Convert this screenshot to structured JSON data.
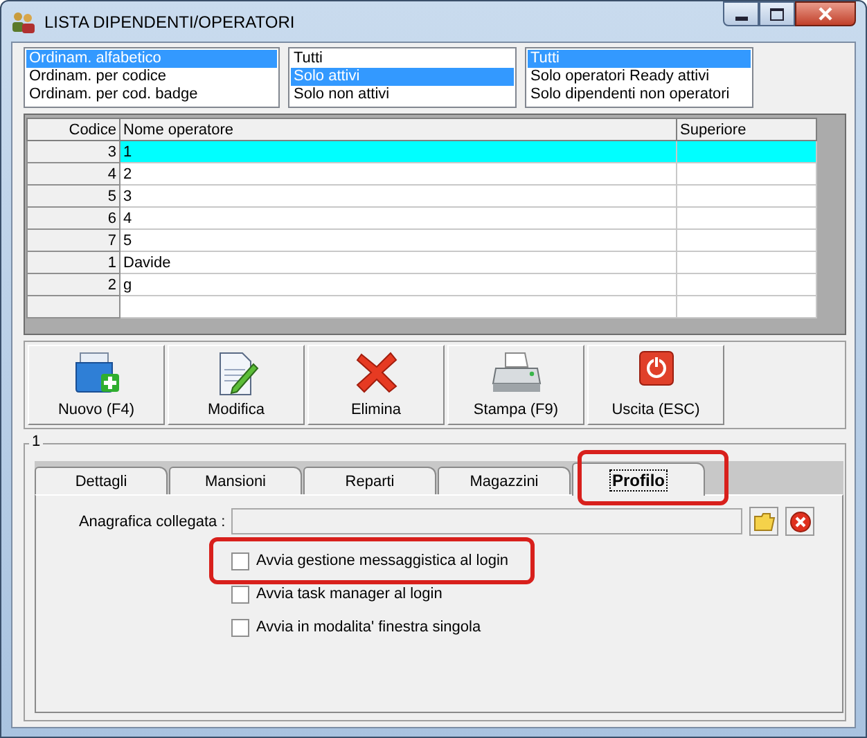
{
  "window": {
    "title": "LISTA DIPENDENTI/OPERATORI"
  },
  "filters": [
    {
      "items": [
        {
          "label": "Ordinam. alfabetico",
          "selected": true
        },
        {
          "label": "Ordinam. per codice",
          "selected": false
        },
        {
          "label": "Ordinam. per cod. badge",
          "selected": false
        }
      ]
    },
    {
      "items": [
        {
          "label": "Tutti",
          "selected": false
        },
        {
          "label": "Solo attivi",
          "selected": true
        },
        {
          "label": "Solo non attivi",
          "selected": false
        }
      ]
    },
    {
      "items": [
        {
          "label": "Tutti",
          "selected": true
        },
        {
          "label": "Solo operatori Ready attivi",
          "selected": false
        },
        {
          "label": "Solo dipendenti non operatori",
          "selected": false
        }
      ]
    }
  ],
  "table": {
    "columns": [
      "Codice",
      "Nome operatore",
      "Superiore"
    ],
    "rows": [
      {
        "codice": "3",
        "nome": "1",
        "selected": true
      },
      {
        "codice": "4",
        "nome": "2",
        "selected": false
      },
      {
        "codice": "5",
        "nome": "3",
        "selected": false
      },
      {
        "codice": "6",
        "nome": "4",
        "selected": false
      },
      {
        "codice": "7",
        "nome": "5",
        "selected": false
      },
      {
        "codice": "1",
        "nome": "Davide",
        "selected": false
      },
      {
        "codice": "2",
        "nome": "g",
        "selected": false
      }
    ]
  },
  "toolbar": [
    {
      "label": "Nuovo (F4)",
      "kind": "new"
    },
    {
      "label": "Modifica",
      "kind": "edit"
    },
    {
      "label": "Elimina",
      "kind": "delete"
    },
    {
      "label": "Stampa (F9)",
      "kind": "print"
    },
    {
      "label": "Uscita (ESC)",
      "kind": "exit"
    }
  ],
  "group": {
    "title": "1",
    "tabs": [
      {
        "label": "Dettagli",
        "selected": false,
        "highlighted": false
      },
      {
        "label": "Mansioni",
        "selected": false,
        "highlighted": false
      },
      {
        "label": "Reparti",
        "selected": false,
        "highlighted": false
      },
      {
        "label": "Magazzini",
        "selected": false,
        "highlighted": false
      },
      {
        "label": "Profilo",
        "selected": true,
        "highlighted": true
      }
    ],
    "linked_record": {
      "label": "Anagrafica collegata :"
    },
    "checkboxes": [
      {
        "label": "Avvia gestione messaggistica al login",
        "checked": false,
        "highlighted": true
      },
      {
        "label": "Avvia task manager al login",
        "checked": false,
        "highlighted": false
      },
      {
        "label": "Avvia in modalita' finestra singola",
        "checked": false,
        "highlighted": false
      }
    ]
  }
}
